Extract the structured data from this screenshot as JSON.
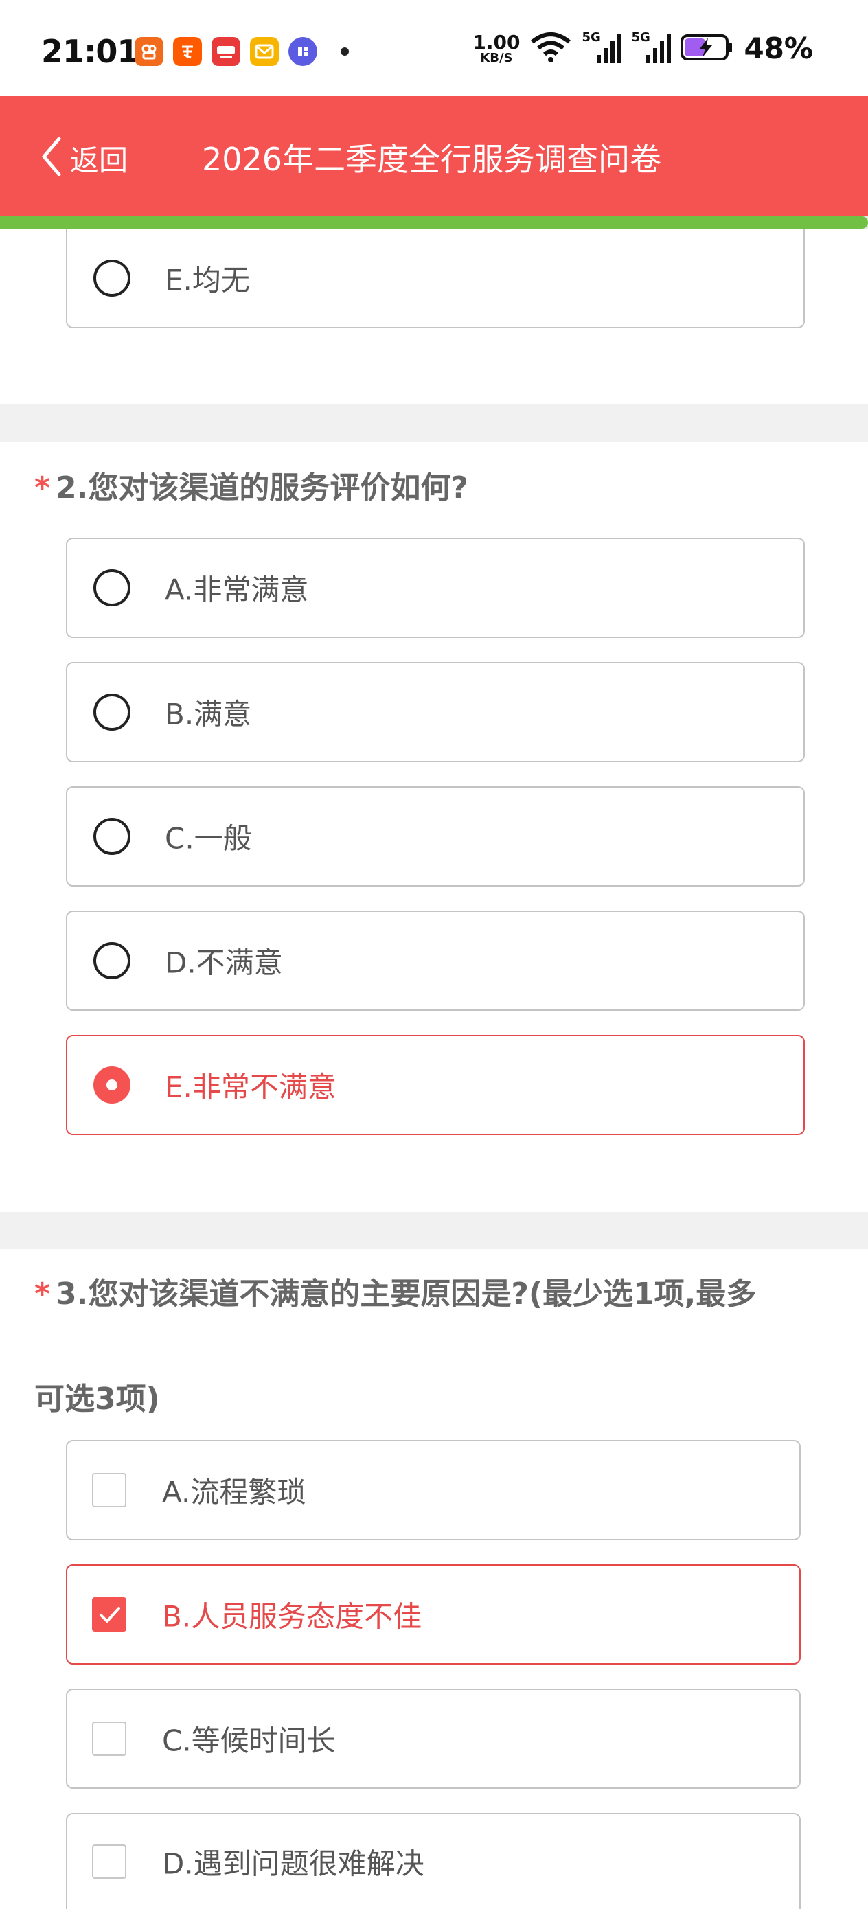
{
  "status_bar": {
    "time": "21:01",
    "net_speed_value": "1.00",
    "net_speed_unit": "KB/S",
    "signal_1_label": "5G",
    "signal_2_label": "5G",
    "battery_percent": "48%",
    "app_icons": [
      "kuaishou-icon",
      "taobao-icon",
      "baijiahao-icon",
      "mail-icon",
      "tieba-icon"
    ]
  },
  "nav": {
    "back_label": "返回",
    "title": "2026年二季度全行服务调查问卷"
  },
  "progress": {
    "fraction": 1.0
  },
  "q1": {
    "options": [
      {
        "label": "E.均无",
        "checked": false
      }
    ]
  },
  "q2": {
    "required_mark": "*",
    "title": "2.您对该渠道的服务评价如何?",
    "options": [
      {
        "label": "A.非常满意",
        "checked": false
      },
      {
        "label": "B.满意",
        "checked": false
      },
      {
        "label": "C.一般",
        "checked": false
      },
      {
        "label": "D.不满意",
        "checked": false
      },
      {
        "label": "E.非常不满意",
        "checked": true
      }
    ]
  },
  "q3": {
    "required_mark": "*",
    "title_line1": "3.您对该渠道不满意的主要原因是?(最少选1项,最多",
    "title_line2": "可选3项)",
    "options": [
      {
        "label": "A.流程繁琐",
        "checked": false
      },
      {
        "label": "B.人员服务态度不佳",
        "checked": true
      },
      {
        "label": "C.等候时间长",
        "checked": false
      },
      {
        "label": "D.遇到问题很难解决",
        "checked": false
      }
    ]
  },
  "colors": {
    "accent": "#f55352",
    "selected_text": "#e5494a",
    "progress": "#72c043"
  }
}
